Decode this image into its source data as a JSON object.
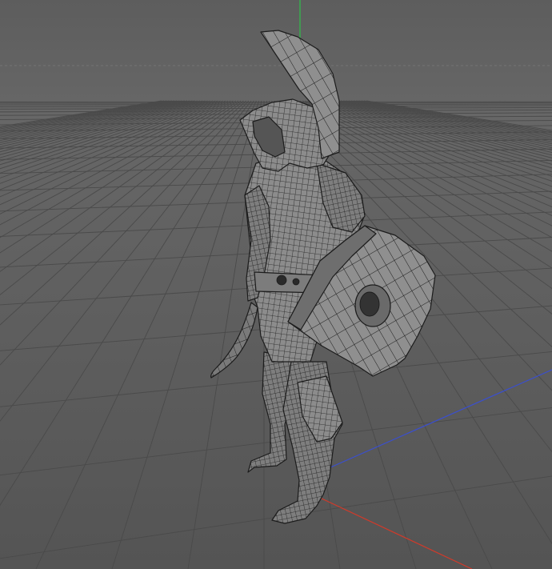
{
  "viewport": {
    "background_top": "#5e5e5e",
    "background_bottom": "#545454",
    "horizon_haze": "#6a6a6a",
    "grid_color": "#4a4a4a",
    "grid_minor_color": "#575757",
    "axis_x_color": "#d03a2a",
    "axis_y_color": "#2fbf4a",
    "axis_z_color": "#3a4fd0",
    "wire_fill": "#8a8a8a",
    "wire_stroke": "#1c1c1c",
    "shading": "flat-wireframe",
    "grid_visible": true
  },
  "model": {
    "icon": "gladiator-wireframe-model",
    "parts": [
      "helmet-crest",
      "helmet",
      "torso",
      "belt",
      "shield",
      "sword",
      "left-leg",
      "right-leg"
    ]
  }
}
